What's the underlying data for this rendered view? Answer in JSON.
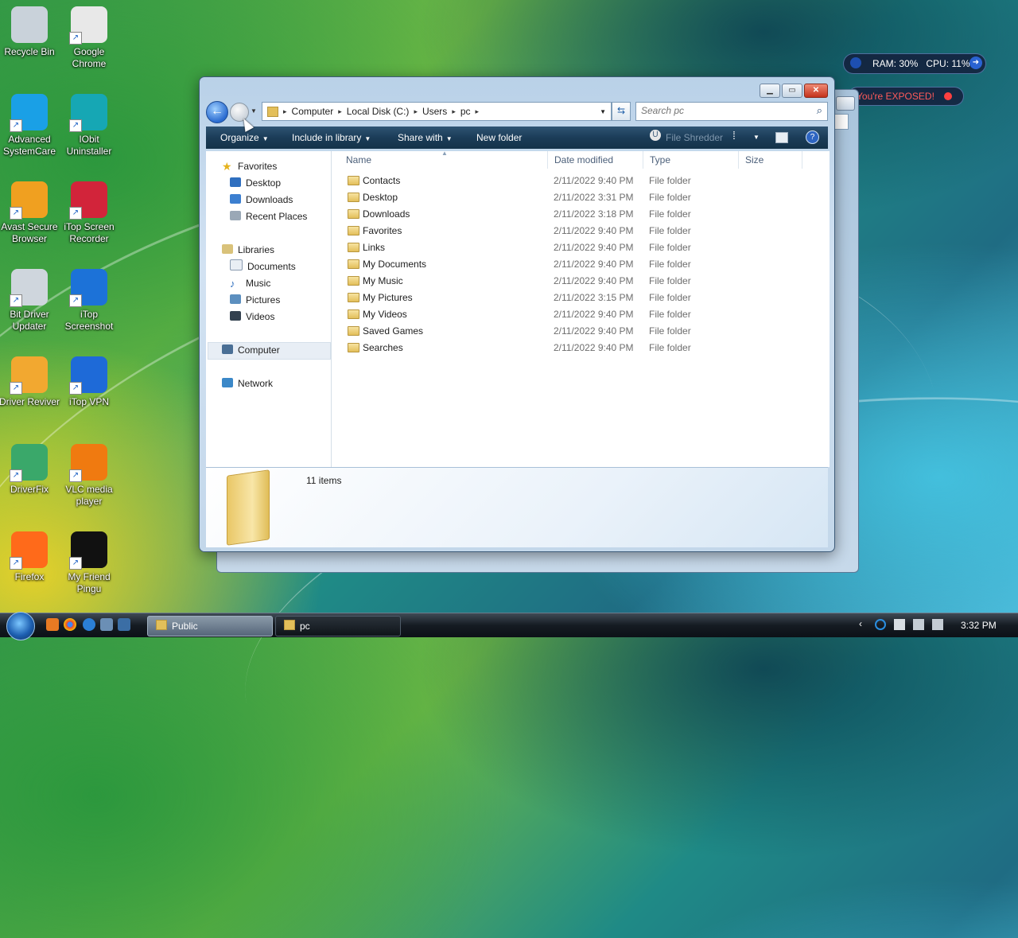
{
  "desktop": {
    "icons": [
      {
        "label": "Recycle Bin",
        "icon": "recycle-bin-icon"
      },
      {
        "label": "Google Chrome",
        "icon": "chrome-icon"
      },
      {
        "label": "Advanced SystemCare",
        "icon": "systemcare-icon"
      },
      {
        "label": "IObit Uninstaller",
        "icon": "iobit-uninstaller-icon"
      },
      {
        "label": "Avast Secure Browser",
        "icon": "avast-browser-icon"
      },
      {
        "label": "iTop Screen Recorder",
        "icon": "screen-recorder-icon"
      },
      {
        "label": "Bit Driver Updater",
        "icon": "driver-updater-icon"
      },
      {
        "label": "iTop Screenshot",
        "icon": "screenshot-icon"
      },
      {
        "label": "Driver Reviver",
        "icon": "driver-reviver-icon"
      },
      {
        "label": "iTop VPN",
        "icon": "vpn-icon"
      },
      {
        "label": "DriverFix",
        "icon": "driverfix-icon"
      },
      {
        "label": "VLC media player",
        "icon": "vlc-icon"
      },
      {
        "label": "Firefox",
        "icon": "firefox-icon"
      },
      {
        "label": "My Friend Pingu",
        "icon": "pingu-icon"
      }
    ]
  },
  "widgets": {
    "ram_cpu": "RAM: 30%   CPU: 11%",
    "exposed": "You're EXPOSED!"
  },
  "window": {
    "address": [
      "Computer",
      "Local Disk (C:)",
      "Users",
      "pc"
    ],
    "search_placeholder": "Search pc",
    "commands": {
      "organize": "Organize",
      "include_in_library": "Include in library",
      "share_with": "Share with",
      "new_folder": "New folder",
      "file_shredder": "File Shredder"
    },
    "nav": {
      "favorites": "Favorites",
      "desktop": "Desktop",
      "downloads": "Downloads",
      "recent_places": "Recent Places",
      "libraries": "Libraries",
      "documents": "Documents",
      "music": "Music",
      "pictures": "Pictures",
      "videos": "Videos",
      "computer": "Computer",
      "network": "Network"
    },
    "columns": {
      "name": "Name",
      "date": "Date modified",
      "type": "Type",
      "size": "Size"
    },
    "files": [
      {
        "name": "Contacts",
        "date": "2/11/2022 9:40 PM",
        "type": "File folder"
      },
      {
        "name": "Desktop",
        "date": "2/11/2022 3:31 PM",
        "type": "File folder"
      },
      {
        "name": "Downloads",
        "date": "2/11/2022 3:18 PM",
        "type": "File folder"
      },
      {
        "name": "Favorites",
        "date": "2/11/2022 9:40 PM",
        "type": "File folder"
      },
      {
        "name": "Links",
        "date": "2/11/2022 9:40 PM",
        "type": "File folder"
      },
      {
        "name": "My Documents",
        "date": "2/11/2022 9:40 PM",
        "type": "File folder"
      },
      {
        "name": "My Music",
        "date": "2/11/2022 9:40 PM",
        "type": "File folder"
      },
      {
        "name": "My Pictures",
        "date": "2/11/2022 3:15 PM",
        "type": "File folder"
      },
      {
        "name": "My Videos",
        "date": "2/11/2022 9:40 PM",
        "type": "File folder"
      },
      {
        "name": "Saved Games",
        "date": "2/11/2022 9:40 PM",
        "type": "File folder"
      },
      {
        "name": "Searches",
        "date": "2/11/2022 9:40 PM",
        "type": "File folder"
      }
    ],
    "item_count": "11 items"
  },
  "taskbar": {
    "buttons": [
      "Public",
      "pc"
    ],
    "clock": "3:32 PM"
  }
}
